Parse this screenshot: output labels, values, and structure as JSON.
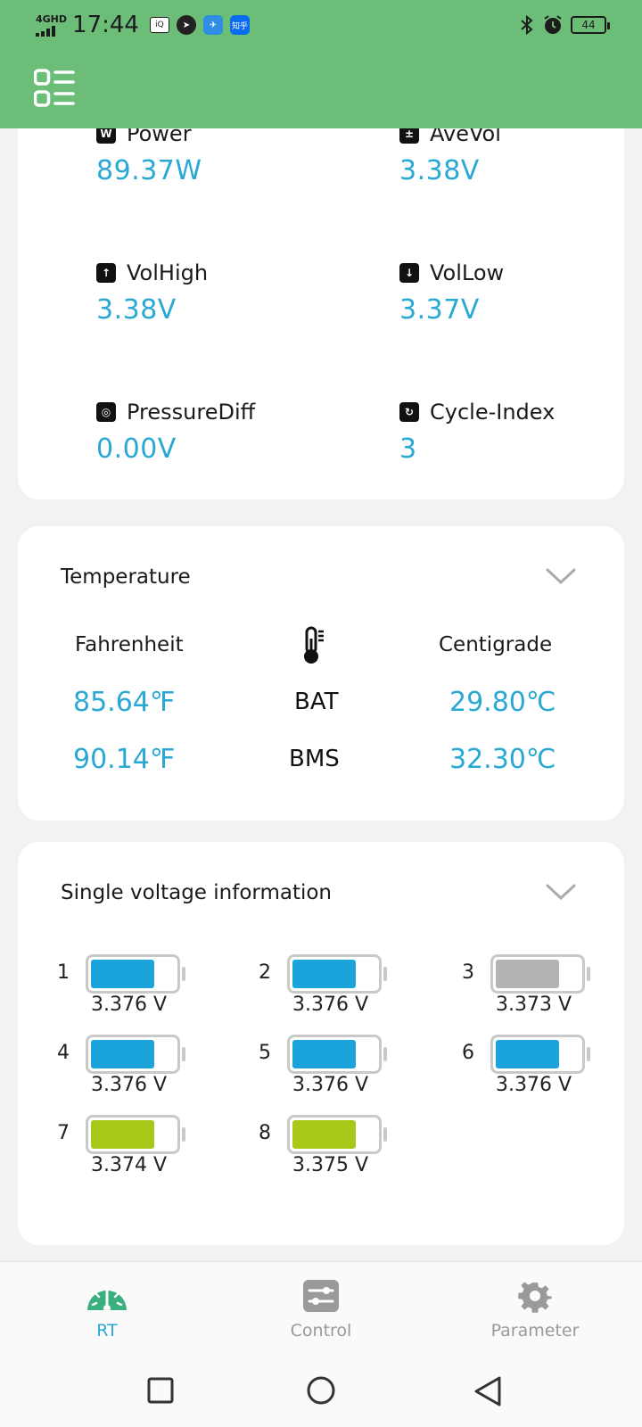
{
  "status_bar": {
    "network": "4GHD",
    "time": "17:44",
    "battery": "44",
    "apps": [
      "iqiyi-icon",
      "compass-icon",
      "bird-icon",
      "zhihu-icon"
    ],
    "app_zhihu_text": "知乎"
  },
  "overview": {
    "metrics": [
      {
        "label": "Power",
        "value": "89.37W",
        "icon": "power-icon",
        "glyph": "W"
      },
      {
        "label": "AveVol",
        "value": "3.38V",
        "icon": "avevol-icon",
        "glyph": "±"
      },
      {
        "label": "VolHigh",
        "value": "3.38V",
        "icon": "volhigh-icon",
        "glyph": "↑"
      },
      {
        "label": "VolLow",
        "value": "3.37V",
        "icon": "vollow-icon",
        "glyph": "↓"
      },
      {
        "label": "PressureDiff",
        "value": "0.00V",
        "icon": "pressure-diff-icon",
        "glyph": "◎"
      },
      {
        "label": "Cycle-Index",
        "value": "3",
        "icon": "cycle-index-icon",
        "glyph": "↻"
      }
    ]
  },
  "temperature": {
    "title": "Temperature",
    "fahrenheit_label": "Fahrenheit",
    "centigrade_label": "Centigrade",
    "rows": [
      {
        "name": "BAT",
        "fahrenheit": "85.64℉",
        "celsius": "29.80℃"
      },
      {
        "name": "BMS",
        "fahrenheit": "90.14℉",
        "celsius": "32.30℃"
      }
    ]
  },
  "single_voltage": {
    "title": "Single voltage information",
    "cells": [
      {
        "index": "1",
        "voltage": "3.376 V",
        "color": "#1ba3dc",
        "level": 0.76
      },
      {
        "index": "2",
        "voltage": "3.376 V",
        "color": "#1ba3dc",
        "level": 0.76
      },
      {
        "index": "3",
        "voltage": "3.373 V",
        "color": "#b3b3b3",
        "level": 0.76
      },
      {
        "index": "4",
        "voltage": "3.376 V",
        "color": "#1ba3dc",
        "level": 0.76
      },
      {
        "index": "5",
        "voltage": "3.376 V",
        "color": "#1ba3dc",
        "level": 0.76
      },
      {
        "index": "6",
        "voltage": "3.376 V",
        "color": "#1ba3dc",
        "level": 0.76
      },
      {
        "index": "7",
        "voltage": "3.374 V",
        "color": "#a8c81a",
        "level": 0.76
      },
      {
        "index": "8",
        "voltage": "3.375 V",
        "color": "#a8c81a",
        "level": 0.76
      }
    ]
  },
  "bottom_nav": {
    "tabs": [
      {
        "label": "RT",
        "icon": "gauge-icon",
        "active": true
      },
      {
        "label": "Control",
        "icon": "sliders-icon",
        "active": false
      },
      {
        "label": "Parameter",
        "icon": "gear-icon",
        "active": false
      }
    ]
  },
  "colors": {
    "header": "#6cbd78",
    "value": "#2aa8d4"
  }
}
